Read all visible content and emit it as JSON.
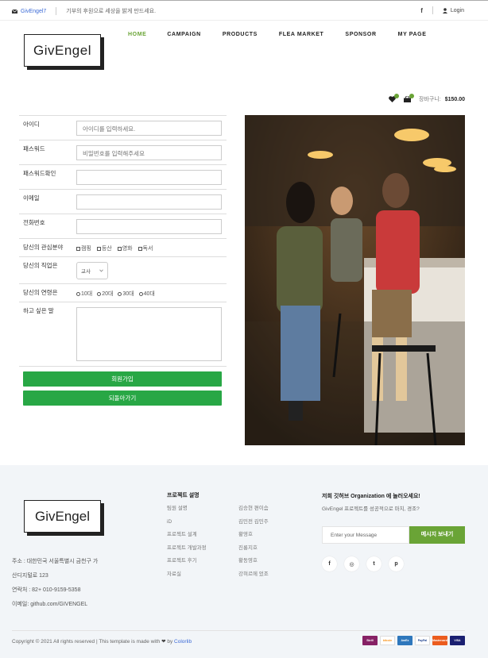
{
  "topbar": {
    "email": "GivEngel7",
    "slogan": "기부의 후원으로 세상을 밝게 만드세요.",
    "facebook": "f",
    "login": "Login"
  },
  "brand": {
    "logo_text": "GivEngel"
  },
  "nav": {
    "items": [
      "HOME",
      "CAMPAIGN",
      "PRODUCTS",
      "FLEA MARKET",
      "SPONSOR",
      "MY PAGE"
    ],
    "active": "HOME"
  },
  "cart": {
    "label": "장바구니:",
    "price": "$150.00",
    "wish_count": "1",
    "cart_count": "2"
  },
  "form": {
    "id_label": "아이디",
    "id_placeholder": "아이디를 입력하세요.",
    "pw_label": "패스워드",
    "pw_placeholder": "비밀번호를 입력해주세요",
    "pw_confirm_label": "패스워드확인",
    "email_label": "이메일",
    "phone_label": "전화번호",
    "interest_label": "당신의 관심분야",
    "interests": [
      "캠핑",
      "등산",
      "영화",
      "독서"
    ],
    "job_label": "당신의 직업은",
    "job_value": "교사",
    "age_label": "당신의 연령은",
    "ages": [
      "10대",
      "20대",
      "30대",
      "40대"
    ],
    "message_label": "하고 싶은 말",
    "signup_button": "회원가입",
    "back_button": "되돌아가기"
  },
  "footer": {
    "address_lines": [
      "주소 : 대한민국 서울특별시 금천구 가",
      "산디지털로 123",
      "연락처 : 82+ 010-9159-5358",
      "이메일: github.com/GIVENGEL"
    ],
    "project_title": "프로젝트 설명",
    "project_col1": [
      "팀원 설명",
      "iD",
      "프로젝트 설계",
      "프로젝트 개발과정",
      "프로젝트 후기",
      "자료실"
    ],
    "project_col2": [
      "김승현 편이슴",
      "김민전 김민주",
      "황영호",
      "진롱지호",
      "황동영호",
      "강혀르에 었조"
    ],
    "newsletter_title_prefix": "저희 깃허브 ",
    "newsletter_title_bold": "Organization",
    "newsletter_title_suffix": " 에 놀러오세요!",
    "newsletter_text": "GivEngel 프로젝트를 성공적으로 마치, 경조?",
    "newsletter_placeholder": "Enter your Message",
    "newsletter_button": "메시지 보내기",
    "social": [
      "f",
      "◎",
      "t",
      "p"
    ],
    "copyright": "Copyright © 2021 All rights reserved | This template is made with",
    "copyright_by": "by",
    "copyright_link": "Colorlib",
    "payments": [
      "Skrill",
      "bitcoin",
      "AmEx",
      "PayPal",
      "Mastercard",
      "VISA"
    ]
  },
  "colors": {
    "accent": "#6aa436",
    "button": "#28a745",
    "link": "#3b6ad6"
  }
}
